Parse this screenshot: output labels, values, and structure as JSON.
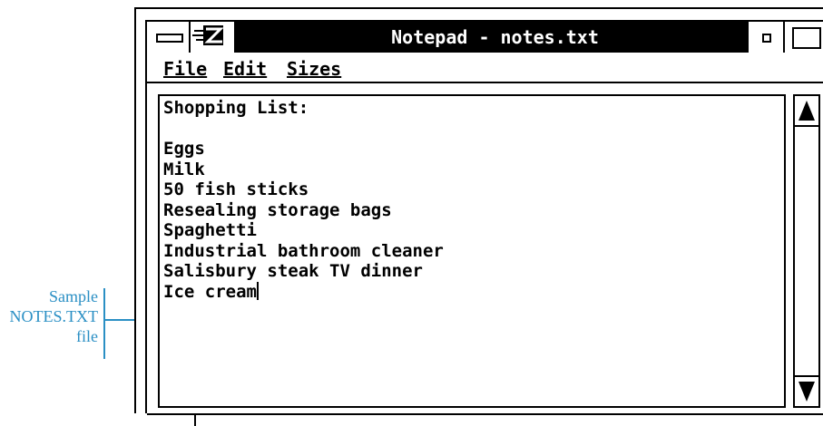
{
  "window": {
    "title": "Notepad - notes.txt"
  },
  "menu": [
    {
      "label": "File"
    },
    {
      "label": "Edit"
    },
    {
      "label": "Sizes"
    }
  ],
  "document": {
    "lines": [
      "Shopping List:",
      "",
      "Eggs",
      "Milk",
      "50 fish sticks",
      "Resealing storage bags",
      "Spaghetti",
      "Industrial bathroom cleaner",
      "Salisbury steak TV dinner",
      "Ice cream"
    ]
  },
  "callout": {
    "line1": "Sample",
    "line2": "NOTES.TXT",
    "line3": "file"
  },
  "colors": {
    "callout": "#2a8fc4",
    "titlebar": "#000000"
  },
  "icons": {
    "system_menu": "system-menu-icon",
    "app": "notepad-app-icon",
    "minimize": "minimize-icon",
    "maximize": "maximize-icon",
    "scroll_up": "scroll-up-arrow-icon",
    "scroll_down": "scroll-down-arrow-icon"
  }
}
